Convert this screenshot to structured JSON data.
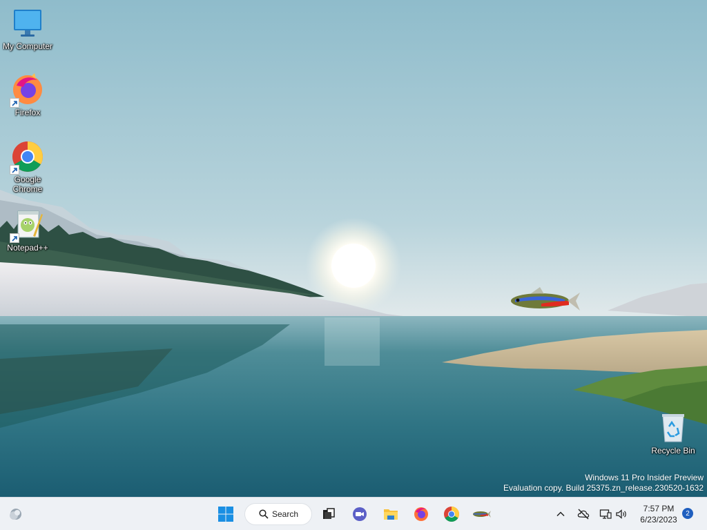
{
  "desktop": {
    "icons": [
      {
        "label": "My Computer",
        "icon": "monitor-icon"
      },
      {
        "label": "Firefox",
        "icon": "firefox-icon"
      },
      {
        "label": "Google Chrome",
        "icon": "chrome-icon"
      },
      {
        "label": "Notepad++",
        "icon": "notepadpp-icon"
      },
      {
        "label": "Recycle Bin",
        "icon": "recycle-bin-icon"
      }
    ],
    "watermark": {
      "line1": "Windows 11 Pro Insider Preview",
      "line2": "Evaluation copy. Build 25375.zn_release.230520-1632"
    }
  },
  "taskbar": {
    "search_label": "Search",
    "pinned": [
      "start-icon",
      "task-view-icon",
      "teams-chat-icon",
      "file-explorer-icon",
      "firefox-icon",
      "chrome-icon",
      "fish-app-icon"
    ],
    "tray": [
      "chevron-up-icon",
      "network-off-icon",
      "display-icon",
      "volume-icon"
    ],
    "clock": {
      "time": "7:57 PM",
      "date": "6/23/2023"
    },
    "notification_count": "2"
  },
  "colors": {
    "taskbar_bg": "#eef1f5",
    "accent": "#1f5fbf"
  }
}
